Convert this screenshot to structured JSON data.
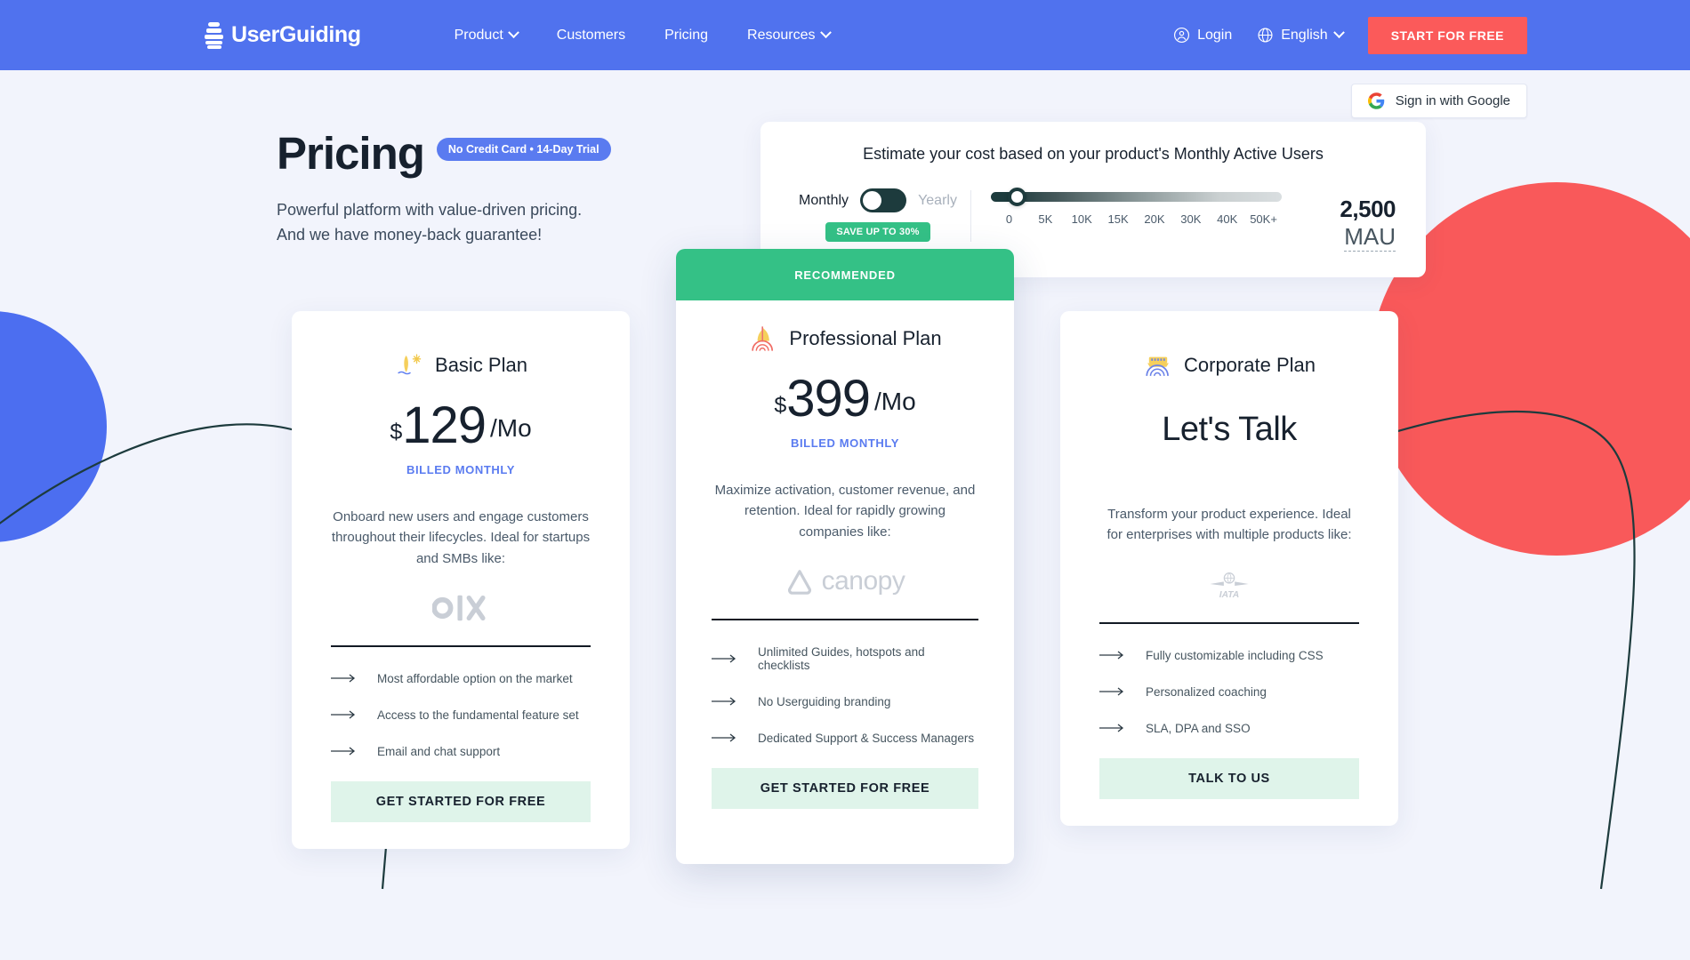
{
  "brand": {
    "name": "UserGuiding",
    "logo_icon": "userguiding-lighthouse-icon"
  },
  "nav": {
    "links": [
      {
        "label": "Product",
        "has_caret": true
      },
      {
        "label": "Customers",
        "has_caret": false
      },
      {
        "label": "Pricing",
        "has_caret": false
      },
      {
        "label": "Resources",
        "has_caret": true
      }
    ],
    "login_label": "Login",
    "language_label": "English",
    "cta_label": "START FOR FREE",
    "cta_color": "#fb5a5a",
    "bar_color": "#5072ee"
  },
  "google_signin": {
    "label": "Sign in with Google"
  },
  "hero": {
    "title": "Pricing",
    "badge": "No Credit Card • 14-Day Trial",
    "badge_color": "#5a7bf0",
    "subtitle_line1": "Powerful platform with value-driven pricing.",
    "subtitle_line2": "And we have money-back guarantee!"
  },
  "estimator": {
    "title": "Estimate your cost based on your product's Monthly Active Users",
    "toggle": {
      "left_label": "Monthly",
      "right_label": "Yearly",
      "selected": "Monthly",
      "save_badge": "SAVE UP TO 30%",
      "save_badge_color": "#34c186"
    },
    "slider": {
      "ticks": [
        "0",
        "5K",
        "10K",
        "15K",
        "20K",
        "30K",
        "40K",
        "50K+"
      ],
      "value_position_percent": 8
    },
    "mau_value": "2,500",
    "mau_unit": "MAU"
  },
  "plans": [
    {
      "id": "basic",
      "icon": "surfboard-sun-icon",
      "name": "Basic Plan",
      "currency": "$",
      "amount": "129",
      "period": "/Mo",
      "billed": "BILLED MONTHLY",
      "description": "Onboard new users and engage customers throughout their lifecycles. Ideal for startups and SMBs like:",
      "customer_logo": "olx-logo",
      "features": [
        "Most affordable option on the market",
        "Access to the fundamental feature set",
        "Email and chat support"
      ],
      "cta_label": "GET STARTED FOR FREE",
      "recommended": false
    },
    {
      "id": "professional",
      "ribbon": "RECOMMENDED",
      "ribbon_color": "#34c186",
      "icon": "sailboat-icon",
      "name": "Professional Plan",
      "currency": "$",
      "amount": "399",
      "period": "/Mo",
      "billed": "BILLED MONTHLY",
      "description": "Maximize activation, customer revenue, and retention. Ideal for rapidly growing companies like:",
      "customer_logo": "canopy-logo",
      "customer_logo_text": "canopy",
      "features": [
        "Unlimited Guides, hotspots and checklists",
        "No Userguiding branding",
        "Dedicated Support & Success Managers"
      ],
      "cta_label": "GET STARTED FOR FREE",
      "recommended": true
    },
    {
      "id": "corporate",
      "icon": "cruise-ship-icon",
      "name": "Corporate Plan",
      "price_text": "Let's Talk",
      "description": "Transform your product experience. Ideal for enterprises with multiple products like:",
      "customer_logo": "iata-logo",
      "customer_logo_text": "IATA",
      "features": [
        "Fully customizable including CSS",
        "Personalized coaching",
        "SLA, DPA and SSO"
      ],
      "cta_label": "TALK TO US",
      "recommended": false
    }
  ],
  "decor": {
    "blue_circle_color": "#4c6ef0",
    "red_circle_color": "#f9595a",
    "line_color": "#1d3b3d",
    "page_background": "#f2f4fc"
  }
}
